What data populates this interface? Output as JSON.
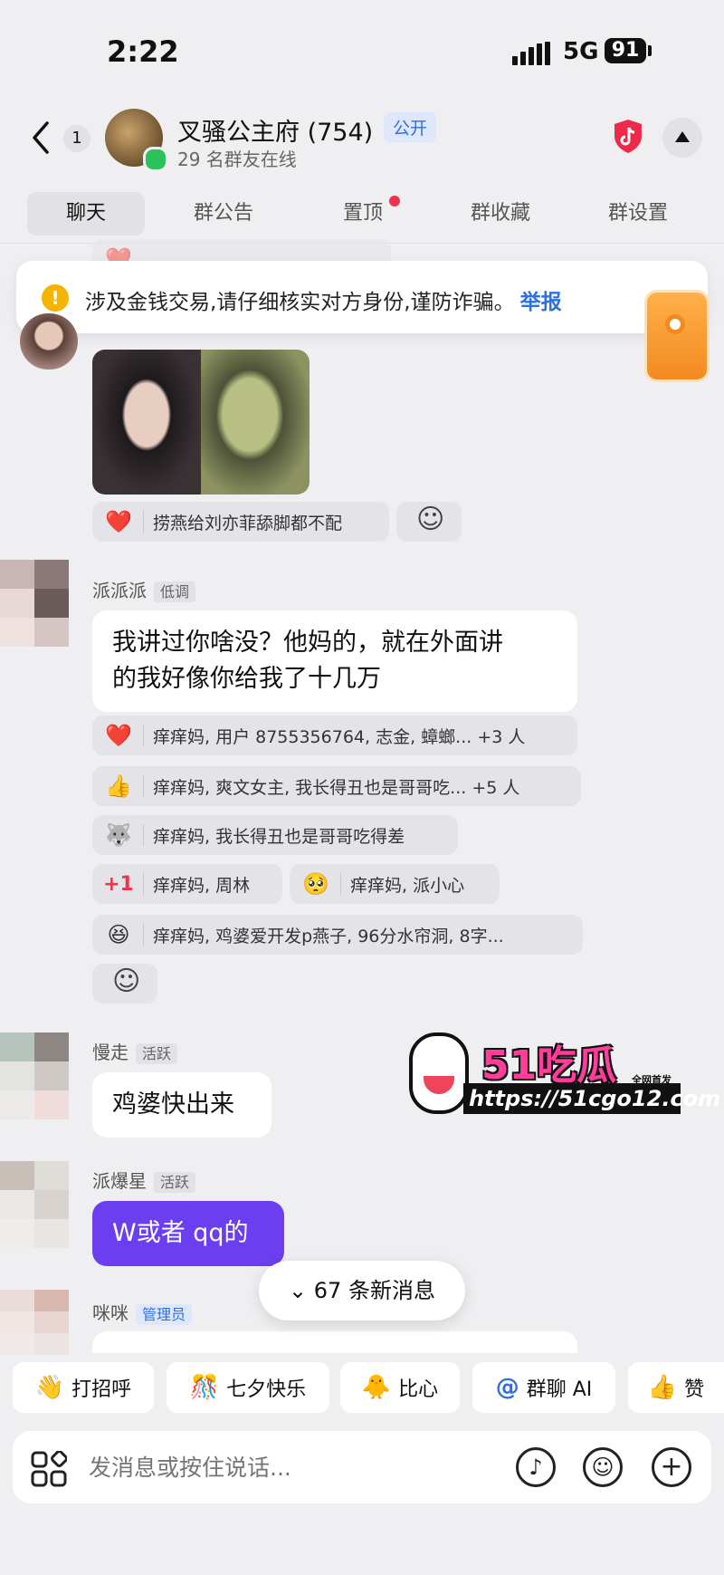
{
  "status": {
    "time": "2:22",
    "network": "5G",
    "battery": "91"
  },
  "header": {
    "unread": "1",
    "group_name": "叉骚公主府 (754)",
    "tag": "公开",
    "online": "29 名群友在线"
  },
  "tabs": [
    {
      "label": "聊天",
      "active": true
    },
    {
      "label": "群公告"
    },
    {
      "label": "置顶",
      "dot": true
    },
    {
      "label": "群收藏"
    },
    {
      "label": "群设置"
    }
  ],
  "banner": {
    "text": "涉及金钱交易,请仔细核实对方身份,谨防诈骗。",
    "link": "举报"
  },
  "reaction_top": {
    "emoji": "❤️",
    "text": "捞燕给刘亦菲舔脚都不配"
  },
  "messages": [
    {
      "name": "派派派",
      "role": "低调",
      "text_line1": "我讲过你啥没？他妈的，就在外面讲",
      "text_line2": "的我好像你给我了十几万",
      "reactions": [
        {
          "emoji": "❤️",
          "text": "痒痒妈, 用户 8755356764, 志金, 蟑螂... +3 人"
        },
        {
          "emoji": "👍",
          "text": "痒痒妈, 爽文女主, 我长得丑也是哥哥吃... +5 人"
        },
        {
          "emoji": "🐺",
          "text": "痒痒妈, 我长得丑也是哥哥吃得差"
        },
        {
          "emoji": "+1",
          "text": "痒痒妈, 周林"
        },
        {
          "emoji": "🥺",
          "text": "痒痒妈, 派小心"
        },
        {
          "emoji": "😆",
          "text": "痒痒妈, 鸡婆爱开发p燕子, 96分水帘洞, 8字..."
        }
      ]
    },
    {
      "name": "慢走",
      "role": "活跃",
      "text": "鸡婆快出来"
    },
    {
      "name": "派爆星",
      "role": "活跃",
      "text": "W或者 qq的"
    },
    {
      "name": "咪咪",
      "role": "管理员"
    }
  ],
  "watermark": {
    "logo": "51吃瓜",
    "url": "https://51cgo12.com",
    "tag": "全网首发"
  },
  "new_messages": "67 条新消息",
  "quick_chips": [
    {
      "icon": "👋",
      "label": "打招呼"
    },
    {
      "icon": "🎊",
      "label": "七夕快乐"
    },
    {
      "icon": "🐥",
      "label": "比心"
    },
    {
      "icon": "@",
      "label": "群聊 AI"
    },
    {
      "icon": "👍",
      "label": "赞"
    }
  ],
  "input": {
    "placeholder": "发消息或按住说话..."
  },
  "colors": {
    "accent": "#2f6fe0",
    "bubble_purple": "#6b3ff0",
    "warning": "#f5b400",
    "online": "#2bc25b"
  }
}
